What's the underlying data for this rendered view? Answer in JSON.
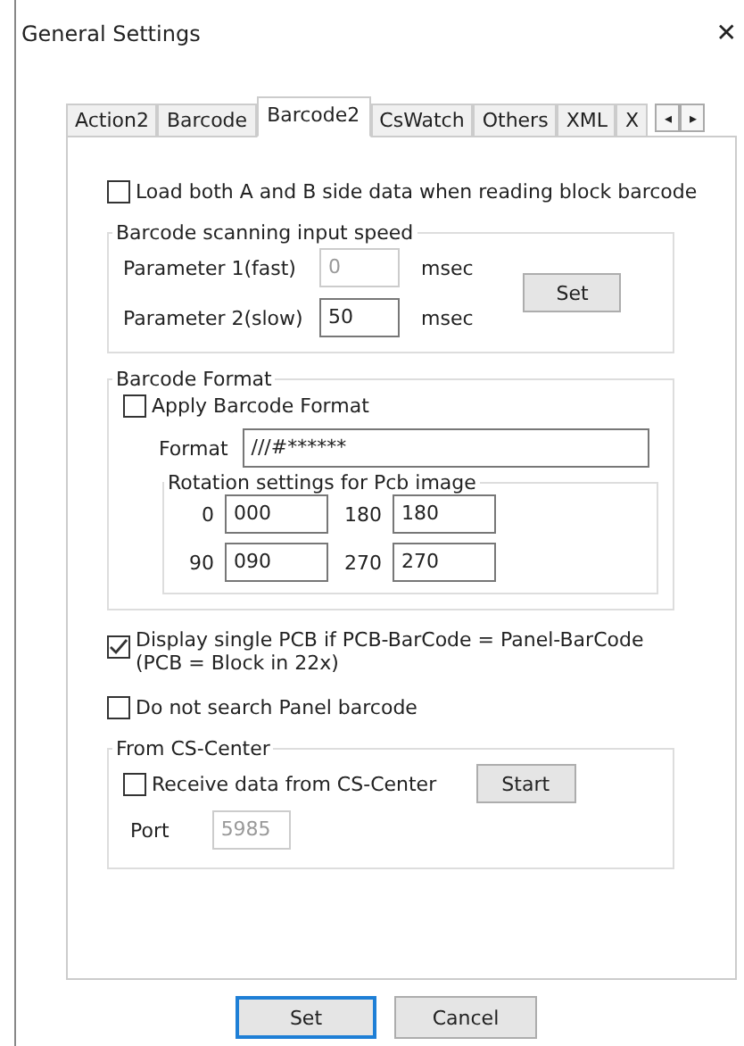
{
  "window": {
    "title": "General Settings",
    "close": "✕"
  },
  "tabs": [
    {
      "label": "Action2",
      "selected": false
    },
    {
      "label": "Barcode",
      "selected": false
    },
    {
      "label": "Barcode2",
      "selected": true
    },
    {
      "label": "CsWatch",
      "selected": false
    },
    {
      "label": "Others",
      "selected": false
    },
    {
      "label": "XML",
      "selected": false
    },
    {
      "label": "X",
      "selected": false
    }
  ],
  "tab_scroll": [
    "◂",
    "▸"
  ],
  "load_both": {
    "label": "Load both A and B side data when reading block barcode",
    "checked": false
  },
  "speed_group": {
    "title": "Barcode scanning input speed",
    "params": [
      {
        "label": "Parameter 1(fast)",
        "value": "0",
        "unit": "msec",
        "disabled": true
      },
      {
        "label": "Parameter 2(slow)",
        "value": "50",
        "unit": "msec",
        "disabled": false
      }
    ],
    "button": "Set"
  },
  "format_group": {
    "title": "Barcode Format",
    "apply": {
      "label": "Apply Barcode Format",
      "checked": false
    },
    "format_label": "Format",
    "format_value": "///#******",
    "rotation": {
      "title": "Rotation settings for Pcb image",
      "items": [
        {
          "label": "0",
          "value": "000"
        },
        {
          "label": "180",
          "value": "180"
        },
        {
          "label": "90",
          "value": "090"
        },
        {
          "label": "270",
          "value": "270"
        }
      ]
    }
  },
  "display_single": {
    "lines": [
      "Display single PCB if PCB-BarCode = Panel-BarCode",
      "(PCB = Block in 22x)"
    ],
    "checked": true
  },
  "no_panel_search": {
    "label": "Do not search Panel barcode",
    "checked": false
  },
  "cs_center": {
    "title": "From CS-Center",
    "receive": {
      "label": "Receive data from CS-Center",
      "checked": false
    },
    "button": "Start",
    "port_label": "Port",
    "port_value": "5985",
    "port_disabled": true
  },
  "buttons": [
    {
      "label": "Set",
      "default": true
    },
    {
      "label": "Cancel",
      "default": false
    }
  ]
}
